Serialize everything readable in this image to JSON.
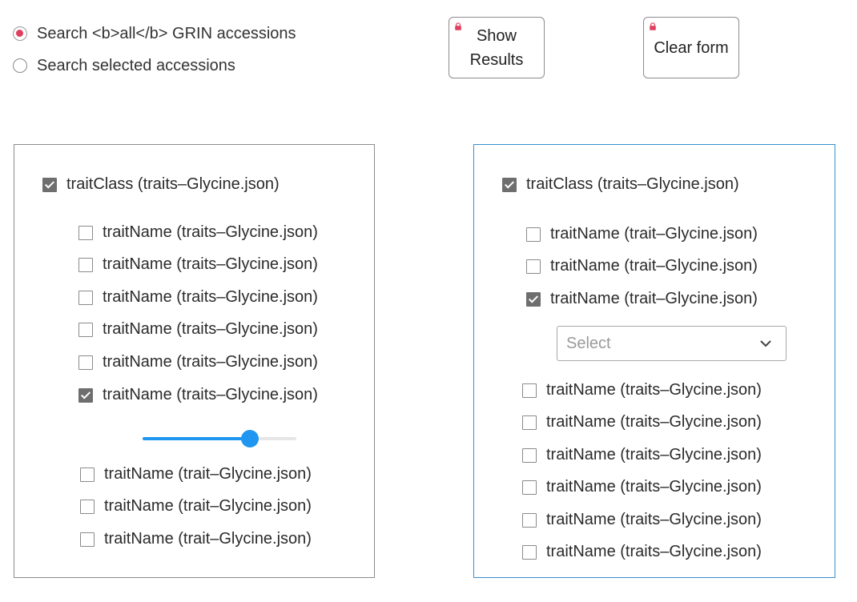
{
  "search_options": [
    {
      "label": "Search <b>all</b> GRIN accessions",
      "checked": true
    },
    {
      "label": "Search selected accessions",
      "checked": false
    }
  ],
  "buttons": {
    "show_results_line1": "Show",
    "show_results_line2": "Results",
    "clear_form": "Clear form",
    "lock_icon": "lock-icon",
    "lock_color": "#e0405d"
  },
  "left_panel": {
    "trait_class": {
      "label": "traitClass (traits–Glycine.json)",
      "checked": true
    },
    "traits_a": [
      {
        "label": "traitName (traits–Glycine.json)",
        "checked": false
      },
      {
        "label": "traitName (traits–Glycine.json)",
        "checked": false
      },
      {
        "label": "traitName (traits–Glycine.json)",
        "checked": false
      },
      {
        "label": "traitName (traits–Glycine.json)",
        "checked": false
      },
      {
        "label": "traitName (traits–Glycine.json)",
        "checked": false
      },
      {
        "label": "traitName (traits–Glycine.json)",
        "checked": true
      }
    ],
    "slider_level": 0.7,
    "slider_color": "#1f96f0",
    "traits_b": [
      {
        "label": "traitName (trait–Glycine.json)",
        "checked": false
      },
      {
        "label": "traitName (trait–Glycine.json)",
        "checked": false
      },
      {
        "label": "traitName (trait–Glycine.json)",
        "checked": false
      }
    ]
  },
  "right_panel": {
    "trait_class": {
      "label": "traitClass (traits–Glycine.json)",
      "checked": true
    },
    "traits_a": [
      {
        "label": "traitName (trait–Glycine.json)",
        "checked": false
      },
      {
        "label": "traitName (trait–Glycine.json)",
        "checked": false
      },
      {
        "label": "traitName (trait–Glycine.json)",
        "checked": true
      }
    ],
    "select_placeholder": "Select",
    "traits_b": [
      {
        "label": "traitName (traits–Glycine.json)",
        "checked": false
      },
      {
        "label": "traitName (traits–Glycine.json)",
        "checked": false
      },
      {
        "label": "traitName (traits–Glycine.json)",
        "checked": false
      },
      {
        "label": "traitName (traits–Glycine.json)",
        "checked": false
      },
      {
        "label": "traitName (traits–Glycine.json)",
        "checked": false
      },
      {
        "label": "traitName (traits–Glycine.json)",
        "checked": false
      }
    ]
  }
}
